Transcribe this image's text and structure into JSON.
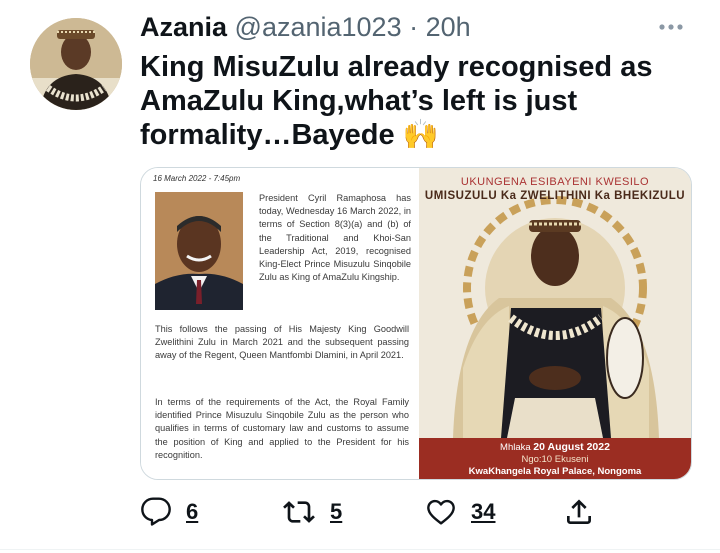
{
  "tweet": {
    "author_name": "Azania",
    "handle": "@azania1023",
    "separator": "·",
    "time": "20h",
    "more_icon": "more-horizontal-icon",
    "text_lines": [
      "King MisuZulu already recognised as",
      "AmaZulu King,what’s left is just",
      "formality…Bayede 🙌"
    ]
  },
  "media": {
    "document": {
      "date": "16 March 2022 - 7:45pm",
      "para1": "President Cyril Ramaphosa has today, Wednesday 16 March 2022, in terms of Section 8(3)(a) and (b) of the Traditional and Khoi-San Leadership Act, 2019, recognised King-Elect Prince Misuzulu Sinqobile Zulu as King of AmaZulu Kingship.",
      "para2": "This follows the passing of His Majesty King Goodwill Zwelithini Zulu in March 2021 and the subsequent passing away of the Regent, Queen Mantfombi Dlamini, in April 2021.",
      "para3": "In terms of the requirements of the Act, the Royal Family identified Prince Misuzulu Sinqobile Zulu as the person who qualifies in terms of customary law and customs to assume the position of King and applied to the President for his recognition."
    },
    "poster": {
      "title1": "UKUNGENA ESIBAYENI KWESILO",
      "title2": "UMISUZULU Ka ZWELITHINI Ka BHEKIZULU",
      "date_prefix": "Mhlaka",
      "date": "20 August 2022",
      "time": "Ngo:10 Ekuseni",
      "venue": "KwaKhangela Royal Palace, Nongoma"
    }
  },
  "actions": {
    "reply_count": "6",
    "retweet_count": "5",
    "like_count": "34"
  },
  "colors": {
    "text": "#0f1419",
    "muted": "#536471",
    "poster_banner": "#9b2d22"
  }
}
